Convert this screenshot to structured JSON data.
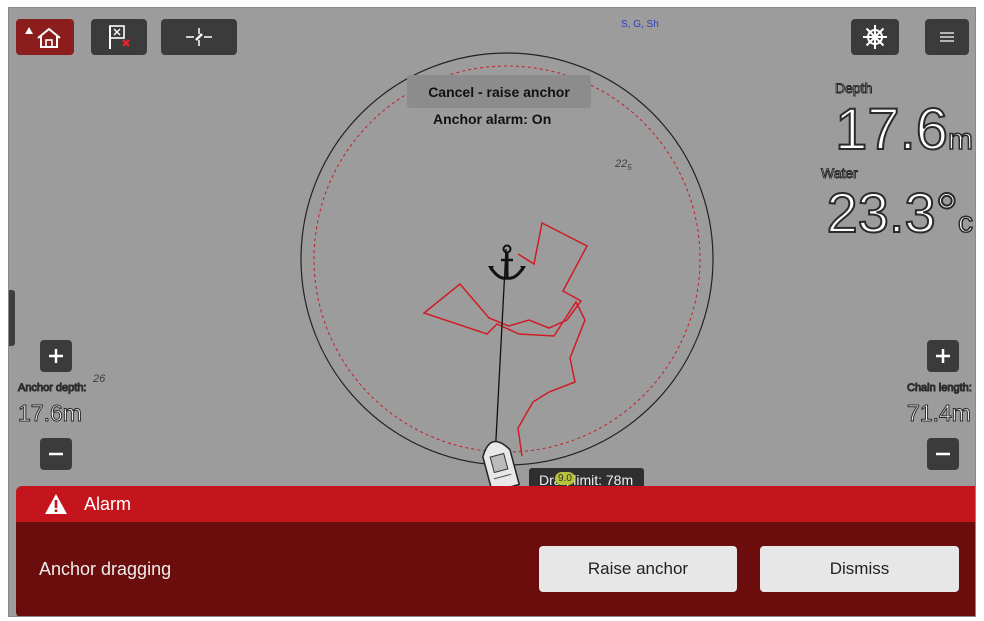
{
  "toolbar": {
    "home_icon": "home-icon",
    "waypoint_icon": "flag-waypoint-icon",
    "position_icon": "crosshair-icon",
    "helm_icon": "ships-wheel-icon",
    "menu_icon": "hamburger-menu-icon",
    "center_status": "S, G, Sh"
  },
  "map": {
    "cancel_label": "Cancel - raise anchor",
    "alarm_status": "Anchor alarm: On",
    "sounding_main": "22",
    "sounding_sub": "5",
    "sounding_left": "26",
    "drag_info": "Drag limit: 78m",
    "drag_badge": "9.0"
  },
  "readouts": {
    "depth_label": "Depth",
    "depth_value": "17.6",
    "depth_unit": "m",
    "water_label": "Water",
    "water_value": "23.3°",
    "water_unit": "c"
  },
  "anchor_depth": {
    "label": "Anchor depth:",
    "value": "17.6m"
  },
  "chain_length": {
    "label": "Chain length:",
    "value": "71.4m"
  },
  "alarm": {
    "title": "Alarm",
    "message": "Anchor dragging",
    "raise_label": "Raise anchor",
    "dismiss_label": "Dismiss"
  },
  "colors": {
    "alarm_header": "#c4151c",
    "alarm_body": "#6b0d0d",
    "track": "#d01c24",
    "screen_bg": "#9c9c9c"
  }
}
